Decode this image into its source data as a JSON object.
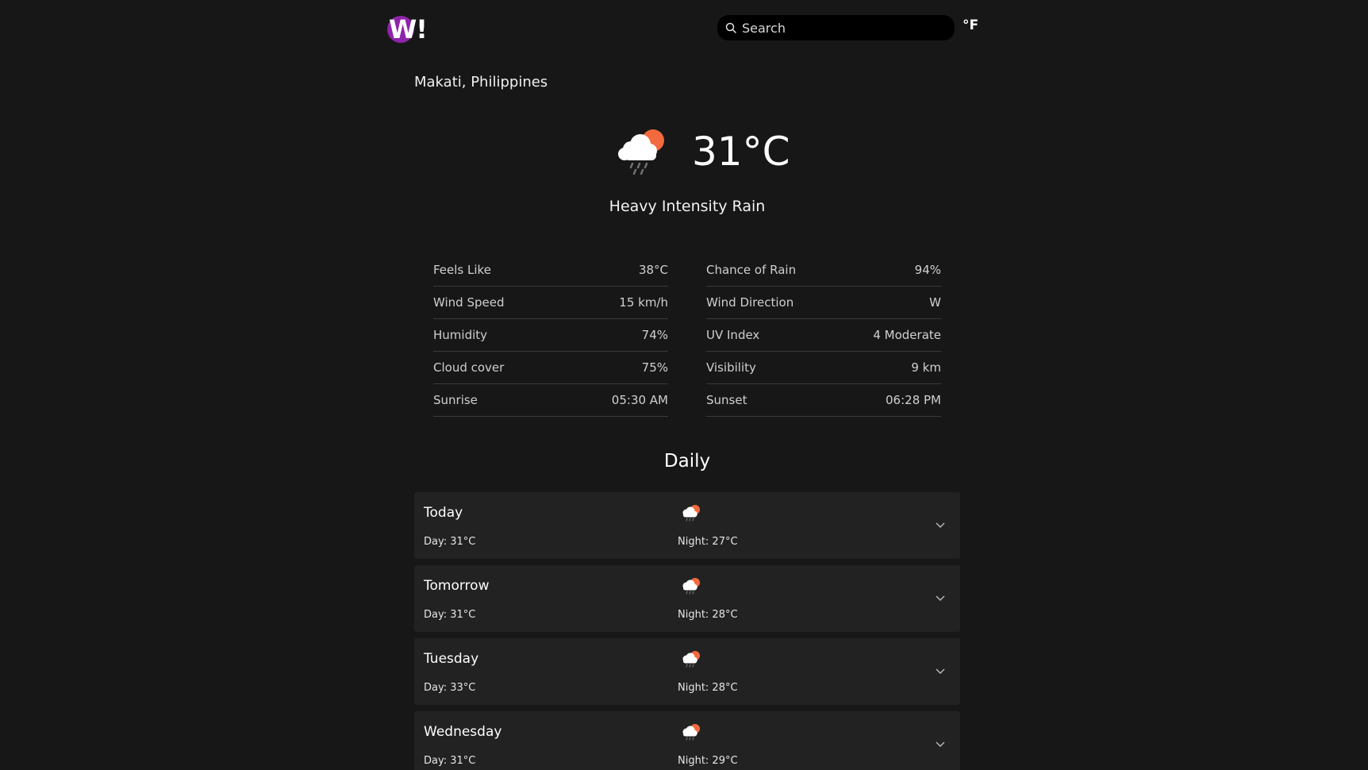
{
  "header": {
    "logo_text": "W!",
    "search_placeholder": "Search",
    "unit_toggle_label": "°F"
  },
  "location": "Makati, Philippines",
  "current": {
    "temperature": "31°C",
    "condition": "Heavy Intensity Rain",
    "icon": "rain-cloud-sun-icon"
  },
  "details": {
    "left": [
      {
        "label": "Feels Like",
        "value": "38°C"
      },
      {
        "label": "Wind Speed",
        "value": "15 km/h"
      },
      {
        "label": "Humidity",
        "value": "74%"
      },
      {
        "label": "Cloud cover",
        "value": "75%"
      },
      {
        "label": "Sunrise",
        "value": "05:30 AM"
      }
    ],
    "right": [
      {
        "label": "Chance of Rain",
        "value": "94%"
      },
      {
        "label": "Wind Direction",
        "value": "W"
      },
      {
        "label": "UV Index",
        "value": "4 Moderate"
      },
      {
        "label": "Visibility",
        "value": "9 km"
      },
      {
        "label": "Sunset",
        "value": "06:28 PM"
      }
    ]
  },
  "daily": {
    "title": "Daily",
    "days": [
      {
        "name": "Today",
        "day": "Day: 31°C",
        "night": "Night: 27°C",
        "icon": "rain-cloud-sun-icon"
      },
      {
        "name": "Tomorrow",
        "day": "Day: 31°C",
        "night": "Night: 28°C",
        "icon": "rain-cloud-sun-icon"
      },
      {
        "name": "Tuesday",
        "day": "Day: 33°C",
        "night": "Night: 28°C",
        "icon": "rain-cloud-sun-icon"
      },
      {
        "name": "Wednesday",
        "day": "Day: 31°C",
        "night": "Night: 29°C",
        "icon": "rain-cloud-sun-icon"
      }
    ]
  },
  "colors": {
    "background": "#171717",
    "card": "#222222",
    "logo": "#8e24aa",
    "sun": "#f26a3d"
  }
}
